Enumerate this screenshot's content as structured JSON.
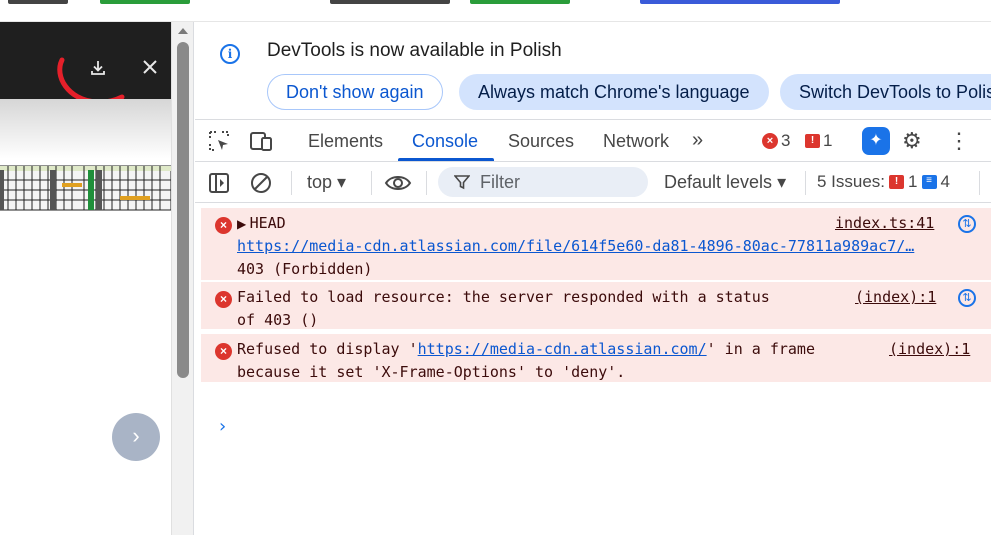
{
  "lang_bar": {
    "message": "DevTools is now available in Polish",
    "dont_show": "Don't show again",
    "always_match": "Always match Chrome's language",
    "switch": "Switch DevTools to Polis"
  },
  "tabs": {
    "elements": "Elements",
    "console": "Console",
    "sources": "Sources",
    "network": "Network",
    "errors_count": "3",
    "warnings_count": "1"
  },
  "filter_bar": {
    "context": "top",
    "filter_placeholder": "Filter",
    "levels": "Default levels",
    "issues_label": "5 Issues:",
    "issues_errors": "1",
    "issues_info": "4"
  },
  "console": {
    "messages": [
      {
        "head": "HEAD",
        "source": "index.ts:41",
        "url": "https://media-cdn.atlassian.com/file/614f5e60-da81-4896-80ac-77811a989ac7/…",
        "status": "403 (Forbidden)"
      },
      {
        "line1": "Failed to load resource: the server responded with a status",
        "line2": "of 403 ()",
        "source": "(index):1"
      },
      {
        "prefix": "Refused to display '",
        "url": "https://media-cdn.atlassian.com/",
        "suffix": "' in a frame",
        "line2": "because it set 'X-Frame-Options' to 'deny'.",
        "source": "(index):1"
      }
    ]
  },
  "colors": {
    "accent": "#0b57d0",
    "error": "#dc362e",
    "error_bg": "#fce8e6",
    "annotation": "#e5202a"
  }
}
